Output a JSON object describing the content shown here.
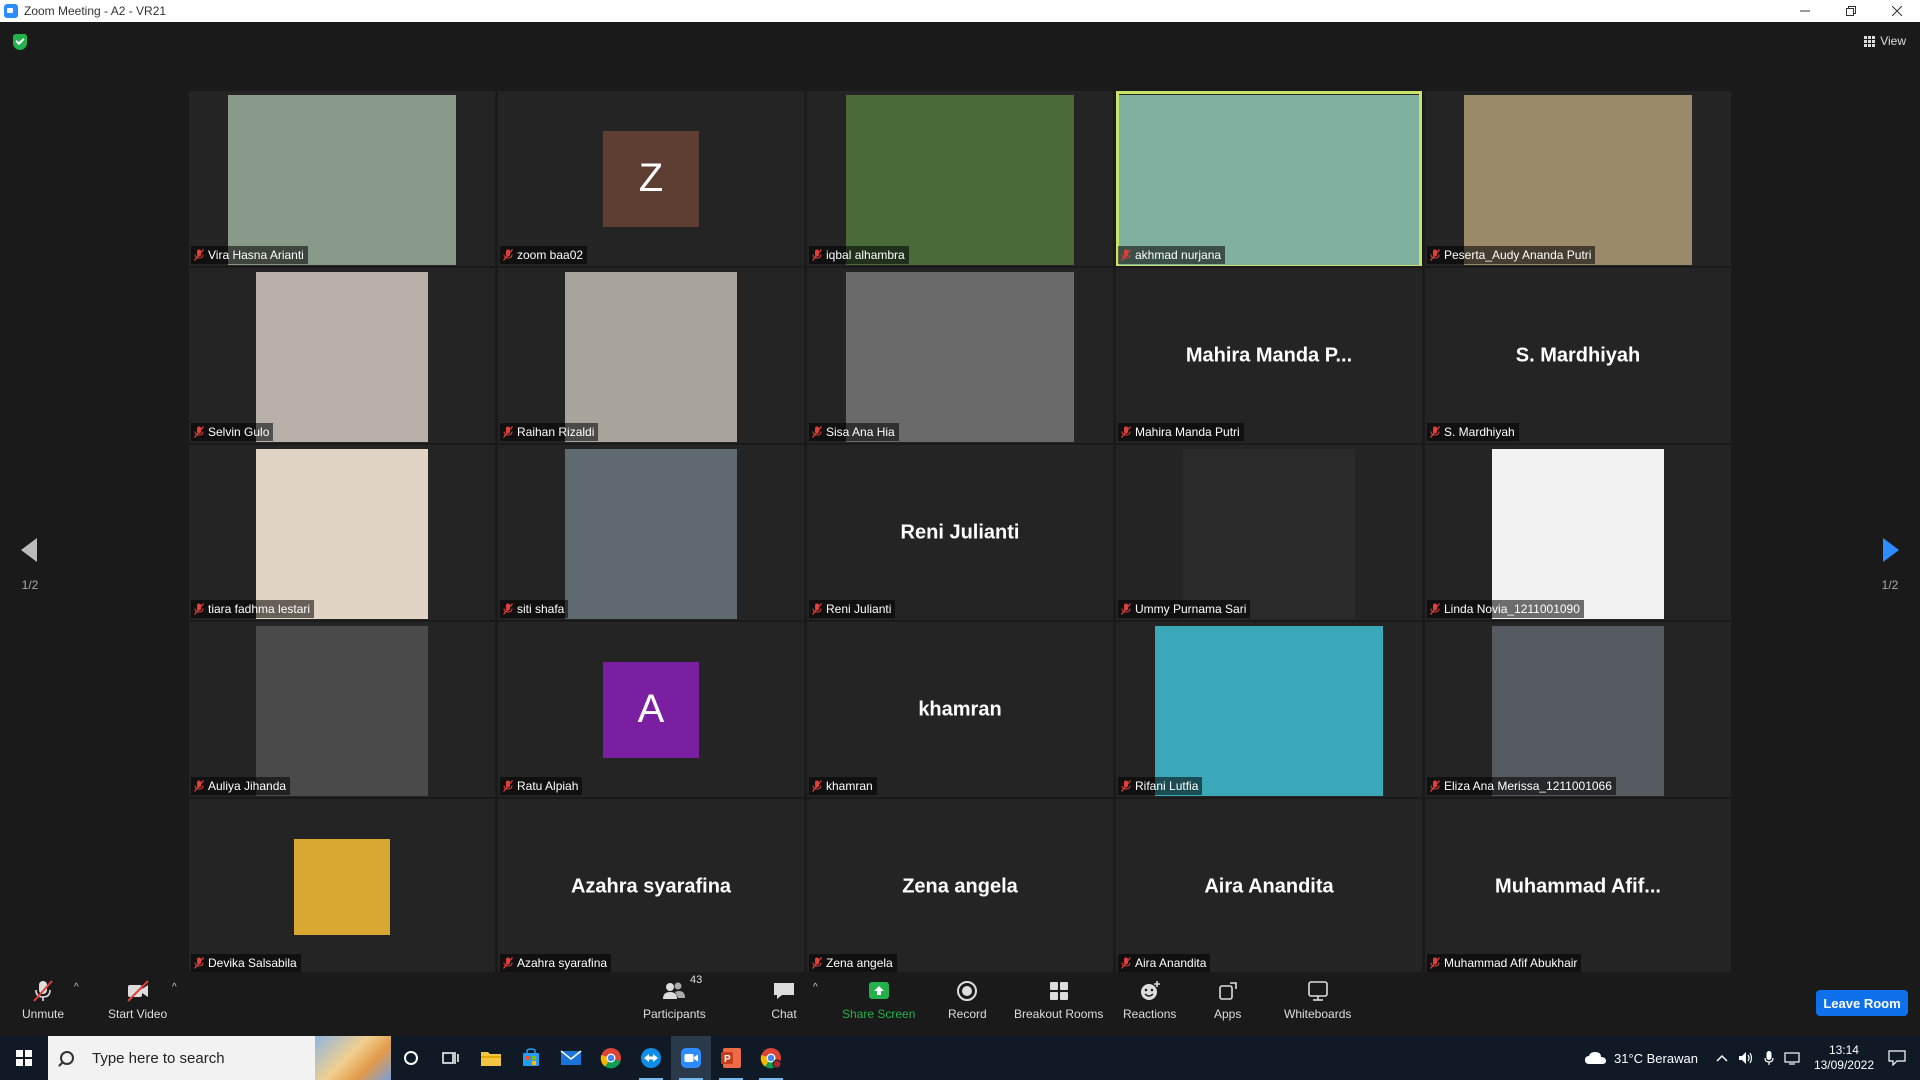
{
  "window": {
    "title": "Zoom Meeting - A2 - VR21",
    "minimize_icon": "minimize-icon",
    "restore_icon": "restore-icon",
    "close_icon": "close-icon"
  },
  "meeting": {
    "view_label": "View",
    "page_indicator_left": "1/2",
    "page_indicator_right": "1/2",
    "active_speaker_color": "#c9e36a"
  },
  "participants": [
    {
      "name": "Vira Hasna Arianti",
      "type": "video",
      "bg": "#8a9a88"
    },
    {
      "name": "zoom baa02",
      "type": "avatar",
      "letter": "Z",
      "avatar_color": "#5e3d33"
    },
    {
      "name": "iqbal alhambra",
      "type": "video",
      "bg": "#4a6a3a"
    },
    {
      "name": "akhmad nurjana",
      "type": "video",
      "bg": "#7fb0a0",
      "active": true
    },
    {
      "name": "Peserta_Audy Ananda Putri",
      "type": "video",
      "bg": "#9a8a6a"
    },
    {
      "name": "Selvin Gulo",
      "type": "video",
      "bg": "#b8b0a8"
    },
    {
      "name": "Raihan Rizaldi",
      "type": "video",
      "bg": "#a8a49c"
    },
    {
      "name": "Sisa Ana Hia",
      "type": "video",
      "bg": "#6a6a6a"
    },
    {
      "name": "Mahira Manda Putri",
      "type": "name",
      "display": "Mahira Manda P..."
    },
    {
      "name": "S. Mardhiyah",
      "type": "name",
      "display": "S. Mardhiyah"
    },
    {
      "name": "tiara fadhma lestari",
      "type": "video",
      "bg": "#e2d4c4"
    },
    {
      "name": "siti shafa",
      "type": "video",
      "bg": "#5f6a70"
    },
    {
      "name": "Reni Julianti",
      "type": "name",
      "display": "Reni Julianti"
    },
    {
      "name": "Ummy Purnama Sari",
      "type": "video",
      "bg": "#2a2a2a"
    },
    {
      "name": "Linda Novia_1211001090",
      "type": "video",
      "bg": "#f2f2f2"
    },
    {
      "name": "Auliya Jihanda",
      "type": "video",
      "bg": "#4a4a4a"
    },
    {
      "name": "Ratu Alpiah",
      "type": "avatar",
      "letter": "A",
      "avatar_color": "#7b1fa2"
    },
    {
      "name": "khamran",
      "type": "name",
      "display": "khamran"
    },
    {
      "name": "Rifani Lutfia",
      "type": "video",
      "bg": "#3aa8b8"
    },
    {
      "name": "Eliza Ana Merissa_1211001066",
      "type": "video",
      "bg": "#555a60"
    },
    {
      "name": "Devika Salsabila",
      "type": "avatar",
      "letter": "",
      "avatar_color": "#d9a832"
    },
    {
      "name": "Azahra syarafina",
      "type": "name",
      "display": "Azahra syarafina"
    },
    {
      "name": "Zena angela",
      "type": "name",
      "display": "Zena angela"
    },
    {
      "name": "Aira Anandita",
      "type": "name",
      "display": "Aira Anandita"
    },
    {
      "name": "Muhammad Afif Abukhair",
      "type": "name",
      "display": "Muhammad  Afif..."
    }
  ],
  "toolbar": {
    "unmute_label": "Unmute",
    "start_video_label": "Start Video",
    "participants_label": "Participants",
    "participants_count": "43",
    "chat_label": "Chat",
    "share_screen_label": "Share Screen",
    "record_label": "Record",
    "breakout_label": "Breakout Rooms",
    "reactions_label": "Reactions",
    "apps_label": "Apps",
    "whiteboards_label": "Whiteboards",
    "leave_label": "Leave Room",
    "share_color": "#22b14c",
    "leave_color": "#0e71eb"
  },
  "taskbar": {
    "search_placeholder": "Type here to search",
    "weather": "31°C  Berawan",
    "time": "13:14",
    "date": "13/09/2022"
  }
}
